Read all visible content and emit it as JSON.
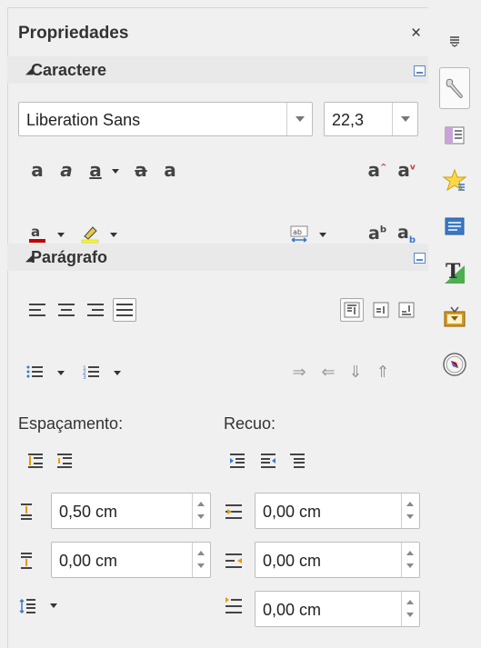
{
  "deck": {
    "title": "Propriedades",
    "close_label": "×"
  },
  "character": {
    "title": "Caractere",
    "font_name": "Liberation Sans",
    "font_size": "22,3"
  },
  "paragraph": {
    "title": "Parágrafo",
    "spacing_label": "Espaçamento:",
    "indent_label": "Recuo:",
    "above_spacing": "0,50 cm",
    "below_spacing": "0,00 cm",
    "before_indent": "0,00 cm",
    "after_indent": "0,00 cm",
    "first_line_indent": "0,00 cm"
  },
  "colors": {
    "font_color": "#c00000",
    "highlight": "#ffff00",
    "accent_blue": "#3a78c9"
  }
}
